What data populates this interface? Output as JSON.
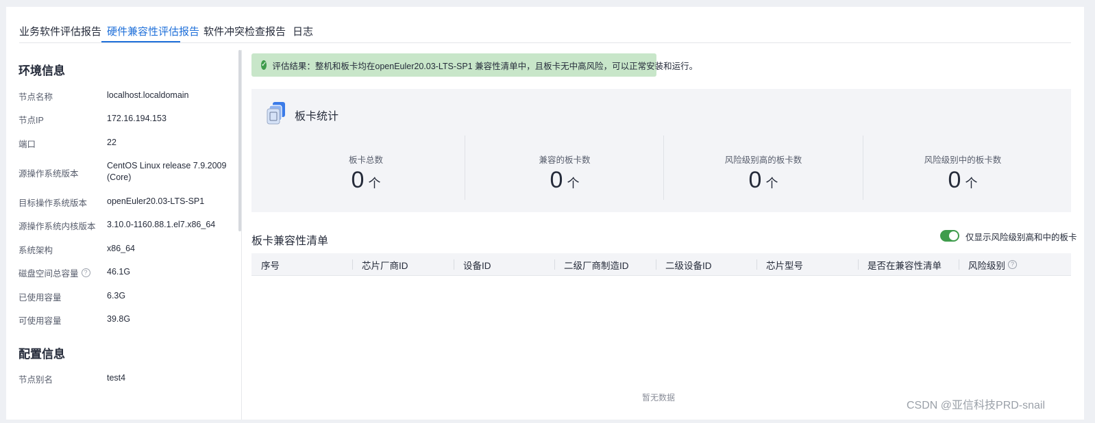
{
  "tabs": [
    {
      "label": "业务软件评估报告",
      "active": false
    },
    {
      "label": "硬件兼容性评估报告",
      "active": true
    },
    {
      "label": "软件冲突检查报告",
      "active": false
    },
    {
      "label": "日志",
      "active": false
    }
  ],
  "env": {
    "title": "环境信息",
    "rows": [
      {
        "label": "节点名称",
        "value": "localhost.localdomain"
      },
      {
        "label": "节点IP",
        "value": "172.16.194.153"
      },
      {
        "label": "端口",
        "value": "22"
      },
      {
        "label": "源操作系统版本",
        "value": "CentOS Linux release 7.9.2009 (Core)"
      },
      {
        "label": "目标操作系统版本",
        "value": "openEuler20.03-LTS-SP1"
      },
      {
        "label": "源操作系统内核版本",
        "value": "3.10.0-1160.88.1.el7.x86_64"
      },
      {
        "label": "系统架构",
        "value": "x86_64"
      },
      {
        "label": "磁盘空间总容量",
        "value": "46.1G"
      },
      {
        "label": "已使用容量",
        "value": "6.3G"
      },
      {
        "label": "可使用容量",
        "value": "39.8G"
      }
    ],
    "help_icon": "?"
  },
  "config": {
    "title": "配置信息",
    "rows": [
      {
        "label": "节点别名",
        "value": "test4"
      }
    ]
  },
  "banner": {
    "text": "评估结果：整机和板卡均在openEuler20.03-LTS-SP1 兼容性清单中，且板卡无中高风险，可以正常安装和运行。",
    "icon": "check-circle-icon",
    "color": "#c8e6c9"
  },
  "stats": {
    "title": "板卡统计",
    "items": [
      {
        "label": "板卡总数",
        "value": "0",
        "unit": "个"
      },
      {
        "label": "兼容的板卡数",
        "value": "0",
        "unit": "个"
      },
      {
        "label": "风险级别高的板卡数",
        "value": "0",
        "unit": "个"
      },
      {
        "label": "风险级别中的板卡数",
        "value": "0",
        "unit": "个"
      }
    ]
  },
  "list": {
    "title": "板卡兼容性清单",
    "toggle_label": "仅显示风险级别高和中的板卡",
    "toggle_on": true,
    "columns": [
      "序号",
      "芯片厂商ID",
      "设备ID",
      "二级厂商制造ID",
      "二级设备ID",
      "芯片型号",
      "是否在兼容性清单",
      "风险级别"
    ],
    "empty_text": "暂无数据"
  },
  "watermark": "CSDN @亚信科技PRD-snail",
  "colors": {
    "accent": "#1e6fd9",
    "success": "#3f9c4c"
  }
}
